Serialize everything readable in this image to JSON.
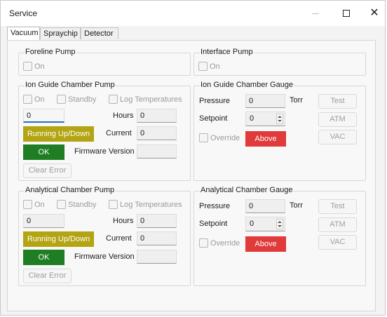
{
  "window": {
    "title": "Service"
  },
  "tabs": [
    {
      "label": "Vacuum",
      "active": true
    },
    {
      "label": "Spraychip",
      "active": false
    },
    {
      "label": "Detector",
      "active": false
    }
  ],
  "foreline_pump": {
    "title": "Foreline Pump",
    "on_label": "On"
  },
  "interface_pump": {
    "title": "Interface Pump",
    "on_label": "On"
  },
  "ion_guide_pump": {
    "title": "Ion Guide Chamber Pump",
    "on_label": "On",
    "standby_label": "Standby",
    "log_label": "Log Temperatures",
    "value": "0",
    "hours_label": "Hours",
    "hours_value": "0",
    "current_label": "Current",
    "current_value": "0",
    "status": "Running Up/Down",
    "status_color": "#b3a413",
    "ok": "OK",
    "ok_color": "#1f7e23",
    "firmware_label": "Firmware Version",
    "firmware_value": "",
    "clear_error": "Clear Error"
  },
  "ion_guide_gauge": {
    "title": "Ion Guide Chamber Gauge",
    "pressure_label": "Pressure",
    "pressure_value": "0",
    "unit": "Torr",
    "setpoint_label": "Setpoint",
    "setpoint_value": "0",
    "override_label": "Override",
    "above": "Above",
    "above_color": "#e03a3a",
    "test": "Test",
    "atm": "ATM",
    "vac": "VAC"
  },
  "analytical_pump": {
    "title": "Analytical Chamber Pump",
    "on_label": "On",
    "standby_label": "Standby",
    "log_label": "Log Temperatures",
    "value": "0",
    "hours_label": "Hours",
    "hours_value": "0",
    "current_label": "Current",
    "current_value": "0",
    "status": "Running Up/Down",
    "status_color": "#b3a413",
    "ok": "OK",
    "ok_color": "#1f7e23",
    "firmware_label": "Firmware Version",
    "firmware_value": "",
    "clear_error": "Clear Error"
  },
  "analytical_gauge": {
    "title": "Analytical Chamber Gauge",
    "pressure_label": "Pressure",
    "pressure_value": "0",
    "unit": "Torr",
    "setpoint_label": "Setpoint",
    "setpoint_value": "0",
    "override_label": "Override",
    "above": "Above",
    "above_color": "#e03a3a",
    "test": "Test",
    "atm": "ATM",
    "vac": "VAC"
  }
}
